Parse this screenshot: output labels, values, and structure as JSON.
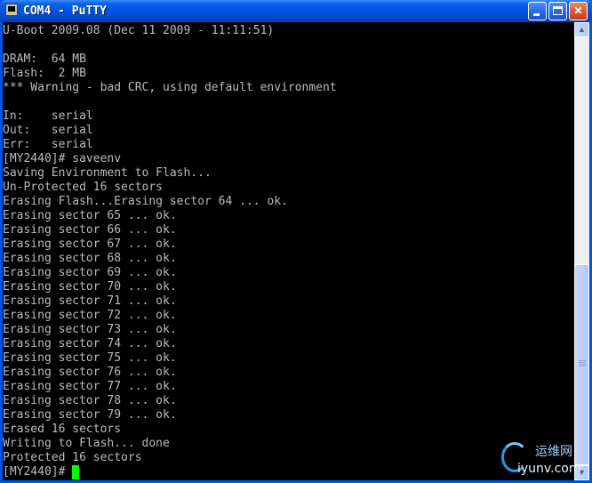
{
  "window": {
    "title": "COM4 - PuTTY",
    "minimize_label": "",
    "maximize_label": "",
    "close_label": "✕"
  },
  "terminal": {
    "lines": [
      "U-Boot 2009.08 (Dec 11 2009 - 11:11:51)",
      "",
      "DRAM:  64 MB",
      "Flash:  2 MB",
      "*** Warning - bad CRC, using default environment",
      "",
      "In:    serial",
      "Out:   serial",
      "Err:   serial",
      "[MY2440]# saveenv",
      "Saving Environment to Flash...",
      "Un-Protected 16 sectors",
      "Erasing Flash...Erasing sector 64 ... ok.",
      "Erasing sector 65 ... ok.",
      "Erasing sector 66 ... ok.",
      "Erasing sector 67 ... ok.",
      "Erasing sector 68 ... ok.",
      "Erasing sector 69 ... ok.",
      "Erasing sector 70 ... ok.",
      "Erasing sector 71 ... ok.",
      "Erasing sector 72 ... ok.",
      "Erasing sector 73 ... ok.",
      "Erasing sector 74 ... ok.",
      "Erasing sector 75 ... ok.",
      "Erasing sector 76 ... ok.",
      "Erasing sector 77 ... ok.",
      "Erasing sector 78 ... ok.",
      "Erasing sector 79 ... ok.",
      "Erased 16 sectors",
      "Writing to Flash... done",
      "Protected 16 sectors"
    ],
    "prompt": "[MY2440]# ",
    "text_color": "#bbbbbb",
    "cursor_color": "#00ff00",
    "background": "#000000"
  },
  "scrollbar": {
    "up_arrow": "▲",
    "down_arrow": "▼"
  },
  "watermark": {
    "top_text": "运维网",
    "site_text": "iyunv.com"
  }
}
